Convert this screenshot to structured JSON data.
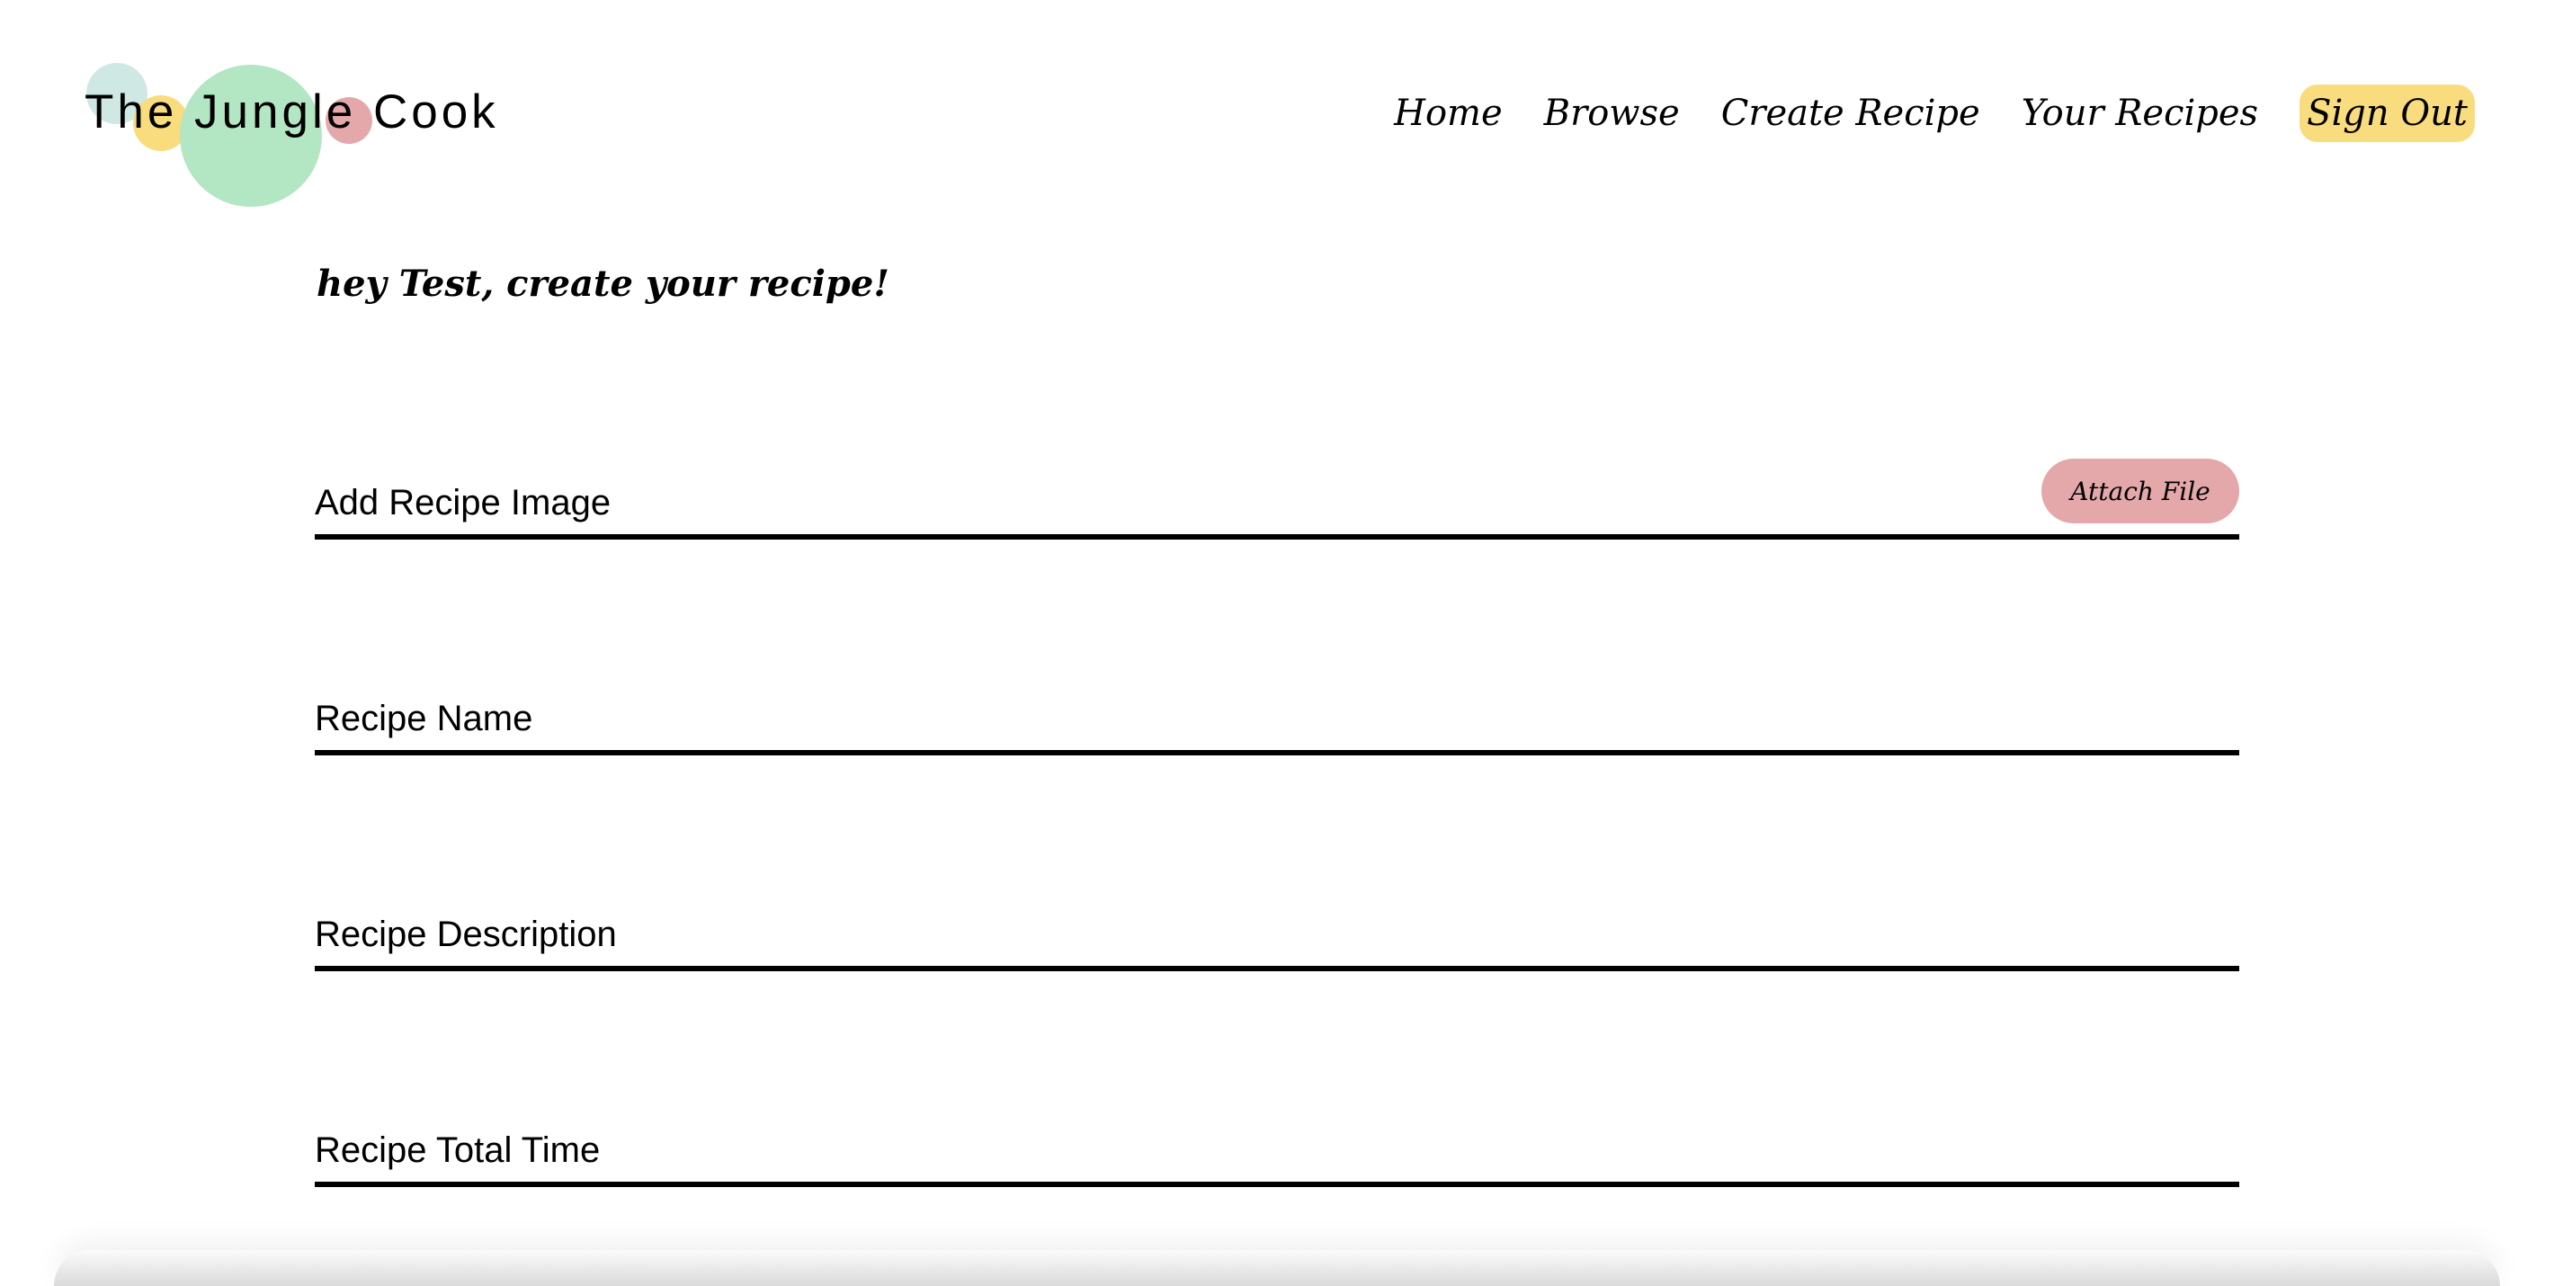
{
  "header": {
    "logo_text": "The Jungle Cook",
    "nav": [
      {
        "label": "Home"
      },
      {
        "label": "Browse"
      },
      {
        "label": "Create Recipe"
      },
      {
        "label": "Your Recipes"
      },
      {
        "label": "Sign Out"
      }
    ]
  },
  "greeting": "hey Test, create your recipe!",
  "form": {
    "image_label": "Add Recipe Image",
    "attach_label": "Attach File",
    "name_label": "Recipe Name",
    "description_label": "Recipe Description",
    "time_label": "Recipe Total Time"
  },
  "colors": {
    "teal": "#cfe8e3",
    "yellow": "#f8dc7e",
    "green": "#b3e6c3",
    "pink": "#e4a8aa",
    "signout_bg": "#f8dc7e",
    "attach_bg": "#e4a8aa"
  },
  "icons": {
    "logo_decoration": "logo-circles-icon"
  }
}
